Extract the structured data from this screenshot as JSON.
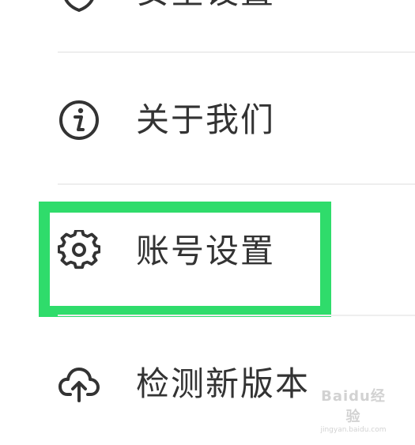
{
  "menu": {
    "items": [
      {
        "label": "安全设置",
        "icon": "shield-icon"
      },
      {
        "label": "关于我们",
        "icon": "info-icon"
      },
      {
        "label": "账号设置",
        "icon": "gear-icon"
      },
      {
        "label": "检测新版本",
        "icon": "cloud-upload-icon"
      }
    ]
  },
  "highlight": {
    "color": "#2fdc6b"
  },
  "watermark": {
    "brand": "Baidu经验",
    "site": "jingyan.baidu.com"
  }
}
